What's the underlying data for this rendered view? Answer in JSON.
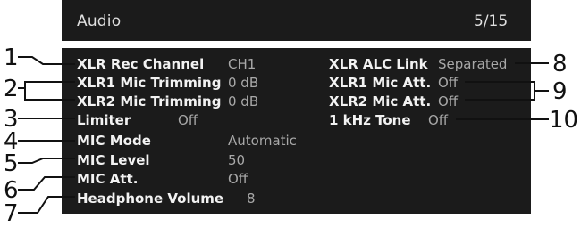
{
  "header": {
    "title": "Audio",
    "page": "5/15"
  },
  "left_items": [
    {
      "label": "XLR Rec Channel",
      "value": "CH1"
    },
    {
      "label": "XLR1 Mic Trimming",
      "value": "0 dB"
    },
    {
      "label": "XLR2 Mic Trimming",
      "value": "0 dB"
    },
    {
      "label": "Limiter",
      "value": "Off"
    },
    {
      "label": "MIC Mode",
      "value": "Automatic"
    },
    {
      "label": "MIC Level",
      "value": "50"
    },
    {
      "label": "MIC Att.",
      "value": "Off"
    },
    {
      "label": "Headphone Volume",
      "value": "8"
    }
  ],
  "right_items": [
    {
      "label": "XLR ALC Link",
      "value": "Separated"
    },
    {
      "label": "XLR1 Mic Att.",
      "value": "Off"
    },
    {
      "label": "XLR2 Mic Att.",
      "value": "Off"
    },
    {
      "label": "1 kHz Tone",
      "value": "Off"
    }
  ],
  "callouts": [
    "1",
    "2",
    "3",
    "4",
    "5",
    "6",
    "7",
    "8",
    "9",
    "10"
  ]
}
